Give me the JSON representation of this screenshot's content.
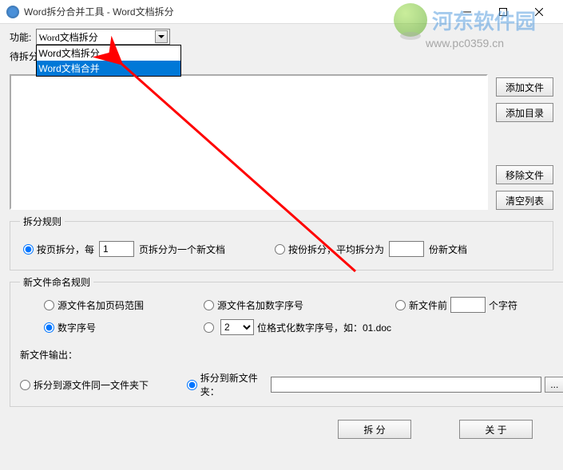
{
  "title": "Word拆分合并工具 - Word文档拆分",
  "func_label": "功能:",
  "combo_selected": "Word文档拆分",
  "combo_options": [
    "Word文档拆分",
    "Word文档合并"
  ],
  "file_label": "待拆分文件",
  "buttons": {
    "add_file": "添加文件",
    "add_dir": "添加目录",
    "remove": "移除文件",
    "clear": "清空列表",
    "split": "拆 分",
    "about": "关 于",
    "browse": "..."
  },
  "rules": {
    "legend": "拆分规则",
    "by_page_prefix": "按页拆分，每",
    "by_page_value": "1",
    "by_page_suffix": "页拆分为一个新文档",
    "by_count_prefix": "按份拆分，平均拆分为",
    "by_count_suffix": "份新文档"
  },
  "naming": {
    "legend": "新文件命名规则",
    "opt1": "源文件名加页码范围",
    "opt2": "源文件名加数字序号",
    "opt3_prefix": "新文件前",
    "opt3_suffix": "个字符",
    "opt4": "数字序号",
    "fmt_sel": "2",
    "fmt_label": "位格式化数字序号，如：01.doc"
  },
  "output": {
    "label": "新文件输出：",
    "same_folder": "拆分到源文件同一文件夹下",
    "new_folder": "拆分到新文件夹："
  },
  "watermark": {
    "name": "河东软件园",
    "url": "www.pc0359.cn"
  }
}
